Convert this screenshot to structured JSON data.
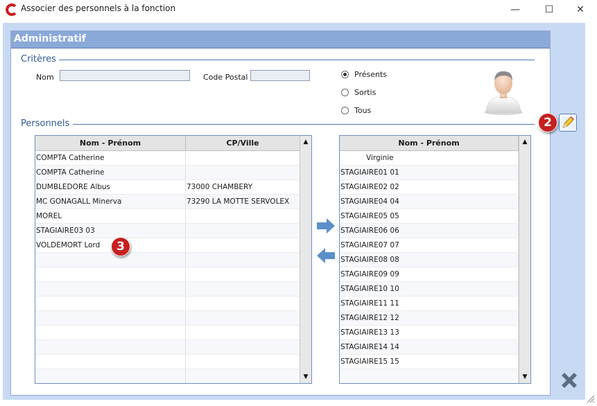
{
  "window": {
    "title": "Associer des personnels à la fonction",
    "minimize_glyph": "—",
    "maximize_glyph": "☐",
    "close_glyph": "✕"
  },
  "panel": {
    "title": "Administratif"
  },
  "criteria": {
    "section_label": "Critères",
    "nom_label": "Nom",
    "nom_value": "",
    "code_postal_label": "Code Postal",
    "code_postal_value": "",
    "radio": [
      {
        "label": "Présents",
        "checked": true
      },
      {
        "label": "Sortis",
        "checked": false
      },
      {
        "label": "Tous",
        "checked": false
      }
    ]
  },
  "personnels": {
    "section_label": "Personnels",
    "left_grid": {
      "headers": [
        "Nom - Prénom",
        "CP/Ville"
      ],
      "rows": [
        [
          "COMPTA Catherine",
          ""
        ],
        [
          "COMPTA Catherine",
          ""
        ],
        [
          "DUMBLEDORE Albus",
          "73000 CHAMBERY"
        ],
        [
          "MC GONAGALL Minerva",
          "73290 LA MOTTE SERVOLEX"
        ],
        [
          "MOREL",
          ""
        ],
        [
          "STAGIAIRE03 03",
          ""
        ],
        [
          "VOLDEMORT Lord",
          ""
        ],
        [
          "",
          ""
        ],
        [
          "",
          ""
        ],
        [
          "",
          ""
        ],
        [
          "",
          ""
        ],
        [
          "",
          ""
        ],
        [
          "",
          ""
        ],
        [
          "",
          ""
        ],
        [
          "",
          ""
        ],
        [
          "",
          ""
        ]
      ]
    },
    "right_grid": {
      "headers": [
        "Nom - Prénom"
      ],
      "rows": [
        "Virginie",
        "STAGIAIRE01 01",
        "STAGIAIRE02 02",
        "STAGIAIRE04 04",
        "STAGIAIRE05 05",
        "STAGIAIRE06 06",
        "STAGIAIRE07 07",
        "STAGIAIRE08 08",
        "STAGIAIRE09 09",
        "STAGIAIRE10 10",
        "STAGIAIRE11 11",
        "STAGIAIRE12 12",
        "STAGIAIRE13 13",
        "STAGIAIRE14 14",
        "STAGIAIRE15 15",
        ""
      ]
    }
  },
  "badges": {
    "edit": "2",
    "list": "3"
  },
  "colors": {
    "accent": "#8aa9d8",
    "frame": "#c8d9f4",
    "badge": "#c62020",
    "arrow": "#5a90c8",
    "delete": "#5b6d80"
  },
  "icons": {
    "app": "app-logo-icon",
    "avatar": "user-avatar-icon",
    "edit": "pencil-edit-icon",
    "add": "arrow-right-icon",
    "remove": "arrow-left-icon",
    "delete": "delete-x-icon",
    "scroll_up": "scroll-up-icon",
    "scroll_down": "scroll-down-icon"
  }
}
